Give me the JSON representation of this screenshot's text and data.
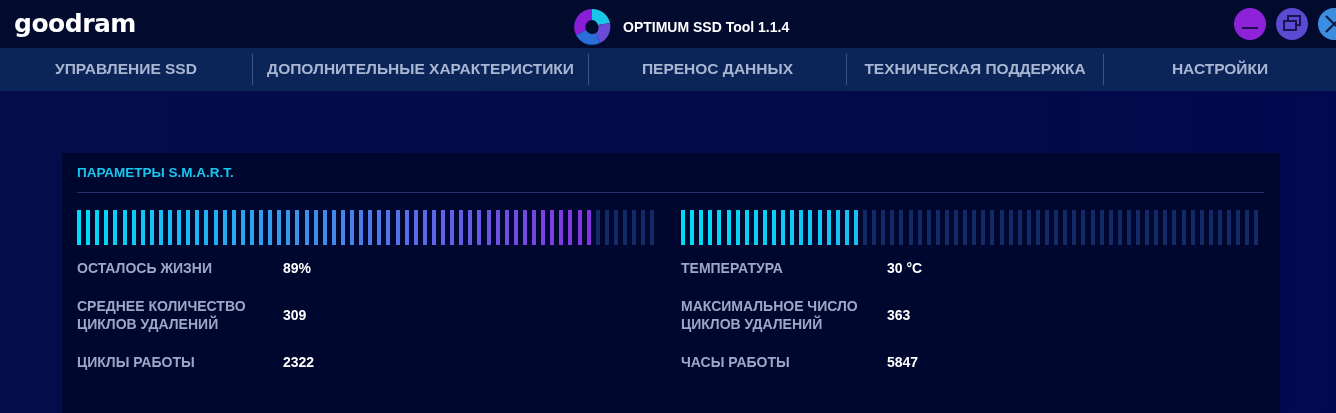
{
  "brand": "goodram",
  "window": {
    "title": "OPTIMUM SSD Tool 1.1.4"
  },
  "tabs": [
    {
      "label": "УПРАВЛЕНИЕ SSD"
    },
    {
      "label": "ДОПОЛНИТЕЛЬНЫЕ ХАРАКТЕРИСТИКИ"
    },
    {
      "label": "ПЕРЕНОС ДАННЫХ"
    },
    {
      "label": "ТЕХНИЧЕСКАЯ ПОДДЕРЖКА"
    },
    {
      "label": "НАСТРОЙКИ"
    }
  ],
  "smart": {
    "title": "ПАРАМЕТРЫ S.M.A.R.T.",
    "columns": [
      {
        "level": 0.89,
        "params": [
          {
            "label": "ОСТАЛОСЬ ЖИЗНИ",
            "value": "89%"
          },
          {
            "label": "СРЕДНЕЕ КОЛИЧЕСТВО ЦИКЛОВ УДАЛЕНИЙ",
            "value": "309"
          },
          {
            "label": "ЦИКЛЫ РАБОТЫ",
            "value": "2322"
          }
        ]
      },
      {
        "level": 0.31,
        "params": [
          {
            "label": "ТЕМПЕРАТУРА",
            "value": "30 °C"
          },
          {
            "label": "МАКСИМАЛЬНОЕ ЧИСЛО ЦИКЛОВ УДАЛЕНИЙ",
            "value": "363"
          },
          {
            "label": "ЧАСЫ РАБОТЫ",
            "value": "5847"
          }
        ]
      }
    ]
  }
}
